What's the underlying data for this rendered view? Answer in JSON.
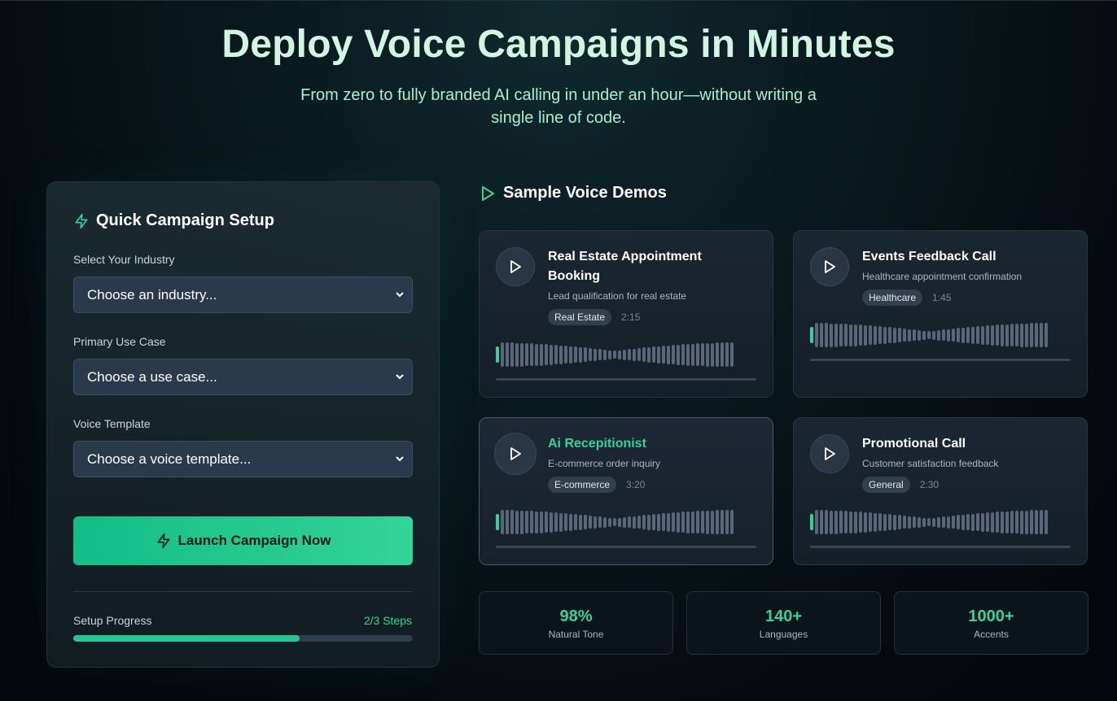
{
  "hero": {
    "title": "Deploy Voice Campaigns in Minutes",
    "subtitle": "From zero to fully branded AI calling in under an hour—without writing a single line of code."
  },
  "setup": {
    "title": "Quick Campaign Setup",
    "icon": "lightning-icon",
    "industry_label": "Select Your Industry",
    "industry_value": "Choose an industry...",
    "use_case_label": "Primary Use Case",
    "use_case_value": "Choose a use case...",
    "template_label": "Voice Template",
    "template_value": "Choose a voice template...",
    "launch_label": "Launch Campaign Now",
    "progress_label": "Setup Progress",
    "progress_steps": "2/3 Steps",
    "progress_fraction": 0.667
  },
  "demos": {
    "title": "Sample Voice Demos",
    "icon": "play-outline-icon",
    "items": [
      {
        "title": "Real Estate Appointment Booking",
        "desc": "Lead qualification for real estate",
        "tag": "Real Estate",
        "duration": "2:15"
      },
      {
        "title": "Events Feedback Call",
        "desc": "Healthcare appointment confirmation",
        "tag": "Healthcare",
        "duration": "1:45"
      },
      {
        "title": "Ai Recepitionist",
        "desc": "E-commerce order inquiry",
        "tag": "E-commerce",
        "duration": "3:20"
      },
      {
        "title": "Promotional Call",
        "desc": "Customer satisfaction feedback",
        "tag": "General",
        "duration": "2:30"
      }
    ]
  },
  "stats": [
    {
      "value": "98%",
      "label": "Natural Tone"
    },
    {
      "value": "140+",
      "label": "Languages"
    },
    {
      "value": "1000+",
      "label": "Accents"
    }
  ],
  "colors": {
    "accent": "#34d399",
    "panel": "#1b2631"
  }
}
